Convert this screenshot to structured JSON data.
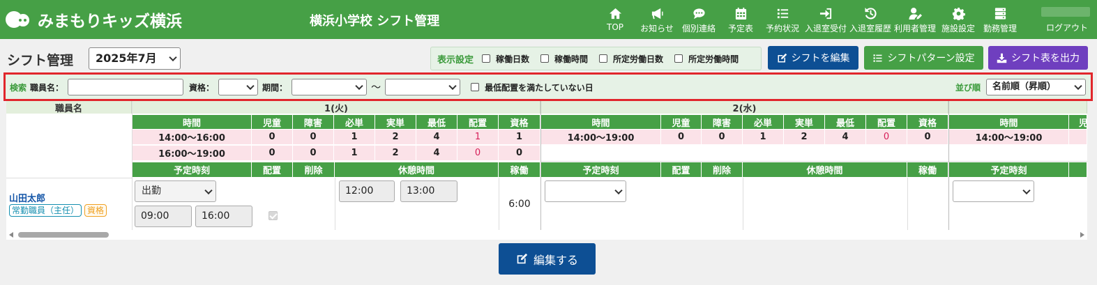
{
  "header": {
    "logo_text": "みまもりキッズ横浜",
    "app_title": "横浜小学校 シフト管理",
    "nav": [
      {
        "label": "TOP",
        "icon": "home-icon"
      },
      {
        "label": "お知らせ",
        "icon": "megaphone-icon"
      },
      {
        "label": "個別連絡",
        "icon": "chat-icon"
      },
      {
        "label": "予定表",
        "icon": "calendar-icon"
      },
      {
        "label": "予約状況",
        "icon": "list-icon"
      },
      {
        "label": "入退室受付",
        "icon": "sign-in-icon"
      },
      {
        "label": "入退室履歴",
        "icon": "history-icon"
      },
      {
        "label": "利用者管理",
        "icon": "user-edit-icon"
      },
      {
        "label": "施設設定",
        "icon": "gear-icon"
      },
      {
        "label": "勤務管理",
        "icon": "server-icon"
      }
    ],
    "logout": "ログアウト"
  },
  "toolbar": {
    "page_title": "シフト管理",
    "month": "2025年7月",
    "display_settings_label": "表示設定",
    "display_options": [
      "稼働日数",
      "稼働時間",
      "所定労働日数",
      "所定労働時間"
    ],
    "edit_shift": "シフトを編集",
    "shift_pattern": "シフトパターン設定",
    "export_shift": "シフト表を出力"
  },
  "search": {
    "title": "検索",
    "staff_label": "職員名：",
    "qualification_label": "資格：",
    "period_label": "期間：",
    "tilde": "〜",
    "min_staff_label": "最低配置を満たしていない日",
    "sort_label": "並び順",
    "sort_value": "名前順（昇順）"
  },
  "table": {
    "staff_header": "職員名",
    "days": [
      {
        "label": "1(火)"
      },
      {
        "label": "2(水)"
      }
    ],
    "summary_headers": [
      "時間",
      "児童",
      "障害",
      "必単",
      "実単",
      "最低",
      "配置",
      "資格"
    ],
    "day1_rows": [
      {
        "time": "14:00〜16:00",
        "jido": "0",
        "shogai": "0",
        "hitsutan": "1",
        "jittan": "2",
        "saitei": "4",
        "haichi": "1",
        "shikaku": "1"
      },
      {
        "time": "16:00〜19:00",
        "jido": "0",
        "shogai": "0",
        "hitsutan": "1",
        "jittan": "2",
        "saitei": "4",
        "haichi": "0",
        "shikaku": "0"
      }
    ],
    "day2_rows": [
      {
        "time": "14:00〜19:00",
        "jido": "0",
        "shogai": "0",
        "hitsutan": "1",
        "jittan": "2",
        "saitei": "4",
        "haichi": "0",
        "shikaku": "0"
      }
    ],
    "day3_partial": {
      "time": "14:00〜19:00",
      "jido_partial": "児"
    },
    "shift_headers": {
      "scheduled": "予定時刻",
      "placement": "配置",
      "delete": "削除",
      "break": "休憩時間",
      "working": "稼働"
    },
    "staff": {
      "name": "山田太郎",
      "employment": "常勤職員（主任）",
      "qualification": "資格",
      "status": "出勤",
      "start": "09:00",
      "end": "16:00",
      "break_start": "12:00",
      "break_end": "13:00",
      "working_hours": "6:00"
    }
  },
  "footer": {
    "edit_button": "編集する"
  }
}
